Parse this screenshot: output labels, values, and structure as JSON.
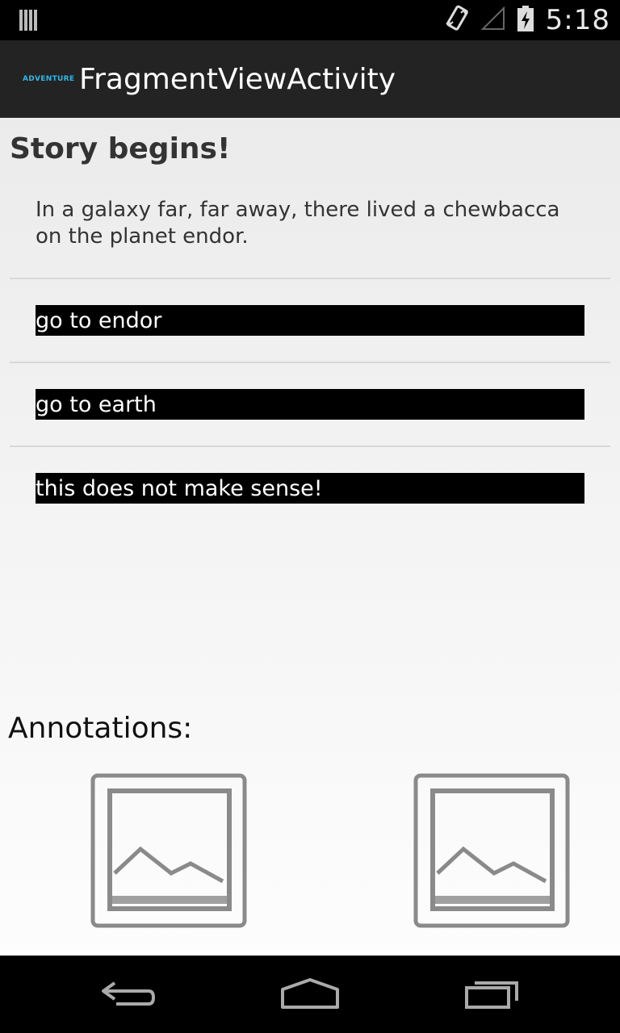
{
  "status_bar": {
    "time": "5:18",
    "icons": [
      "notification-icon",
      "vibrate-icon",
      "no-signal-icon",
      "battery-charging-icon"
    ]
  },
  "action_bar": {
    "logo_text": "ADVENTURE",
    "title": "FragmentViewActivity"
  },
  "story": {
    "title": "Story begins!",
    "text": "In a galaxy far, far away, there lived a chewbacca on the planet endor."
  },
  "choices": [
    {
      "label": "go to endor"
    },
    {
      "label": "go to earth"
    },
    {
      "label": "this does not make sense!"
    }
  ],
  "annotations": {
    "label": "Annotations:",
    "images": [
      "image-placeholder-icon",
      "image-placeholder-icon"
    ]
  },
  "nav_bar": {
    "buttons": [
      "back-icon",
      "home-icon",
      "recent-apps-icon"
    ]
  },
  "colors": {
    "logo_accent": "#33b5e5",
    "action_bar": "#232323",
    "choice_background": "#000000",
    "choice_text": "#ffffff"
  }
}
